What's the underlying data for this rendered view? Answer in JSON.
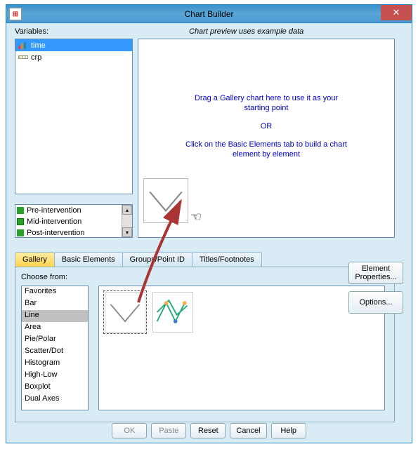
{
  "window": {
    "title": "Chart Builder"
  },
  "labels": {
    "variables": "Variables:",
    "preview": "Chart preview uses example data",
    "choose": "Choose from:"
  },
  "variables": [
    {
      "name": "time",
      "icon": "bar-chart-icon",
      "selected": true
    },
    {
      "name": "crp",
      "icon": "ruler-icon",
      "selected": false
    }
  ],
  "canvas": {
    "line1": "Drag a Gallery chart here to use it as your",
    "line2": "starting point",
    "or": "OR",
    "line3": "Click on the Basic Elements tab to build a chart",
    "line4": "element by element"
  },
  "categories": [
    "Pre-intervention",
    "Mid-intervention",
    "Post-intervention"
  ],
  "tabs": [
    {
      "id": "gallery",
      "label": "Gallery",
      "active": true
    },
    {
      "id": "basic",
      "label": "Basic Elements",
      "active": false
    },
    {
      "id": "groups",
      "label": "Groups/Point ID",
      "active": false
    },
    {
      "id": "titles",
      "label": "Titles/Footnotes",
      "active": false
    }
  ],
  "gallery": {
    "types": [
      "Favorites",
      "Bar",
      "Line",
      "Area",
      "Pie/Polar",
      "Scatter/Dot",
      "Histogram",
      "High-Low",
      "Boxplot",
      "Dual Axes"
    ],
    "selected": "Line"
  },
  "side": {
    "element_properties": "Element Properties...",
    "options": "Options..."
  },
  "buttons": {
    "ok": "OK",
    "paste": "Paste",
    "reset": "Reset",
    "cancel": "Cancel",
    "help": "Help"
  }
}
